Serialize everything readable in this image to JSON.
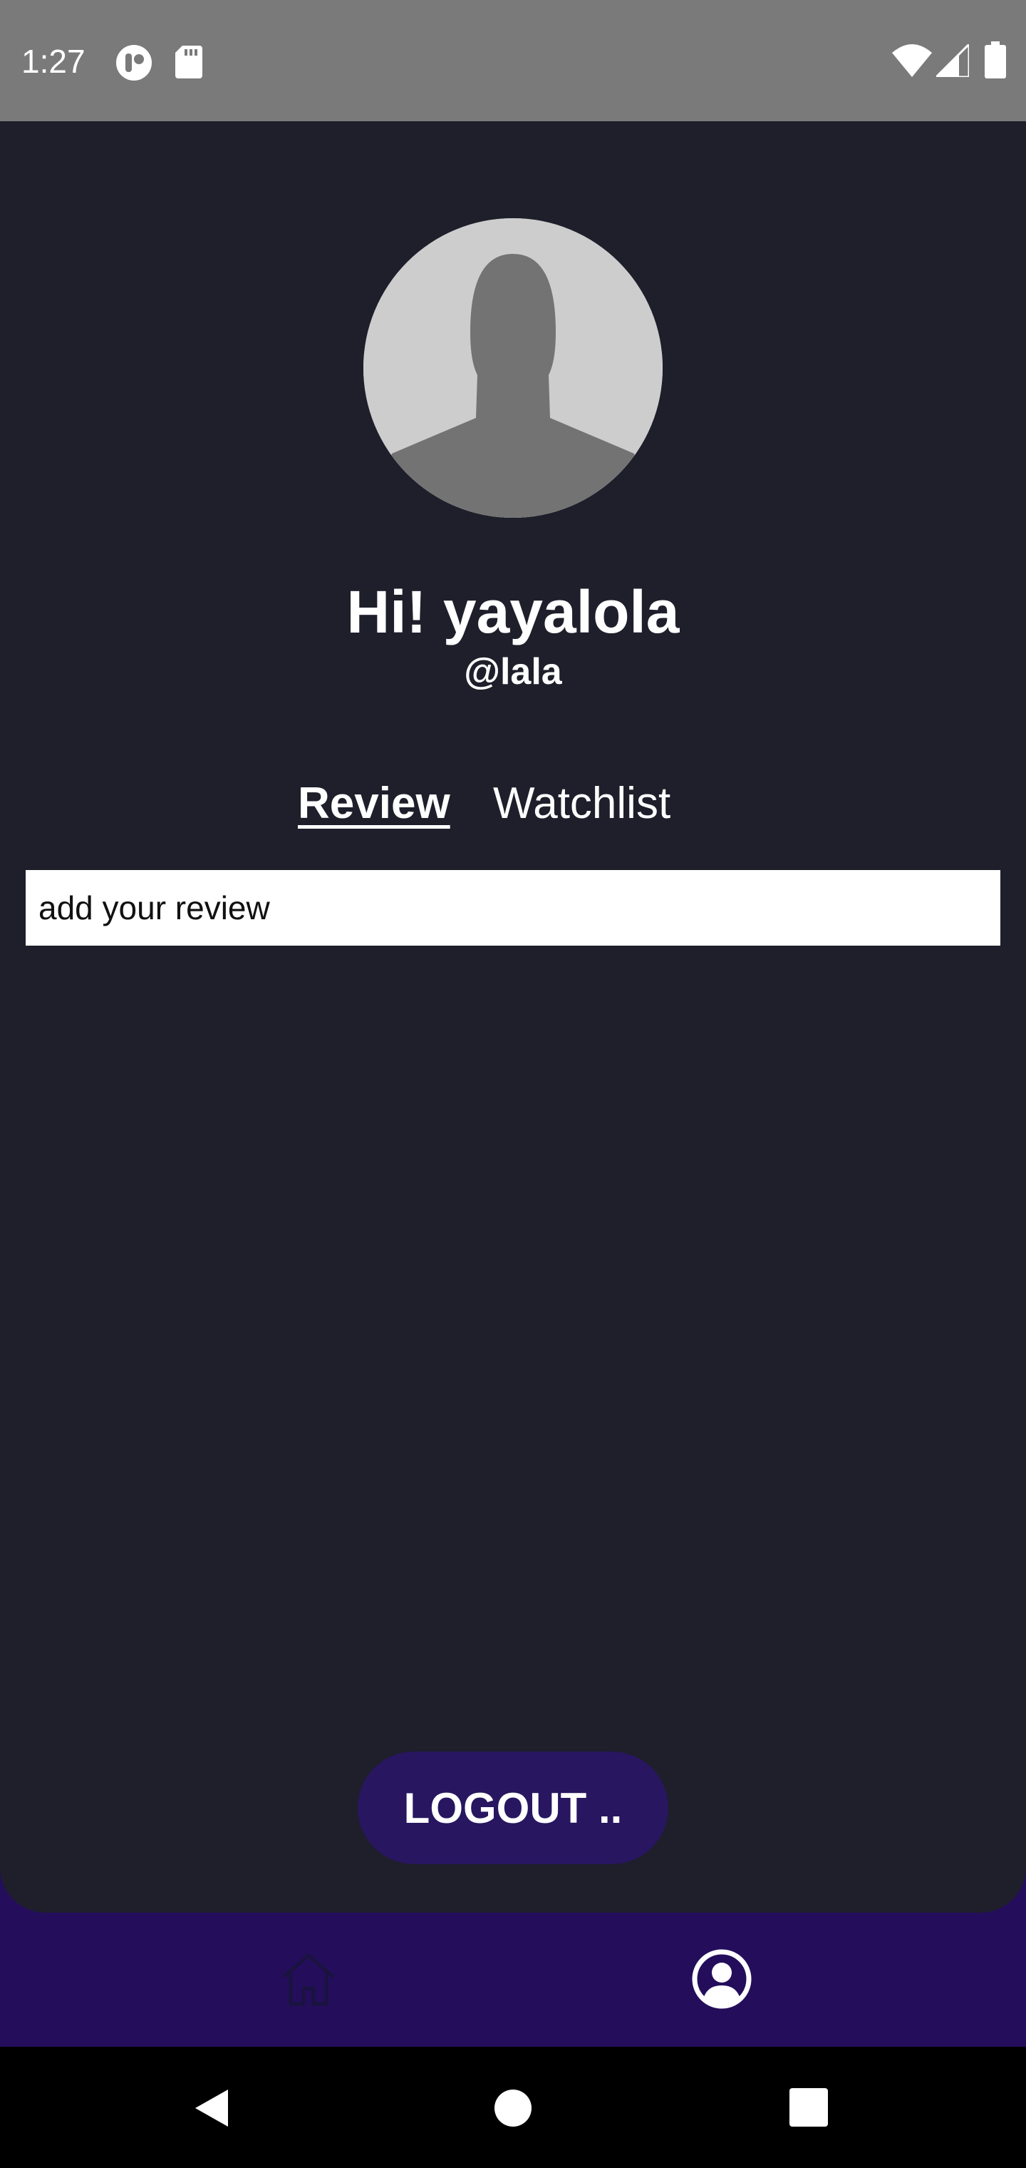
{
  "status_bar": {
    "time": "1:27",
    "icons": [
      "notification-app-icon",
      "sd-card-icon",
      "wifi-icon",
      "cell-signal-icon",
      "battery-icon"
    ]
  },
  "profile": {
    "greeting": "Hi! yayalola",
    "handle": "@lala"
  },
  "tabs": [
    {
      "label": "Review",
      "selected": true
    },
    {
      "label": "Watchlist",
      "selected": false
    }
  ],
  "review_input": {
    "placeholder": "add your review",
    "value": ""
  },
  "logout_button": {
    "label": "LOGOUT .."
  },
  "bottom_nav": {
    "items": [
      {
        "icon": "home-icon",
        "active": false
      },
      {
        "icon": "profile-icon",
        "active": true
      }
    ]
  },
  "system_nav": {
    "buttons": [
      "back-icon",
      "home-circle-icon",
      "recents-icon"
    ]
  },
  "colors": {
    "background": "#1e1f2b",
    "status_bar": "#7a7a7a",
    "accent": "#240e5b",
    "button": "#281660",
    "text": "#ffffff"
  }
}
